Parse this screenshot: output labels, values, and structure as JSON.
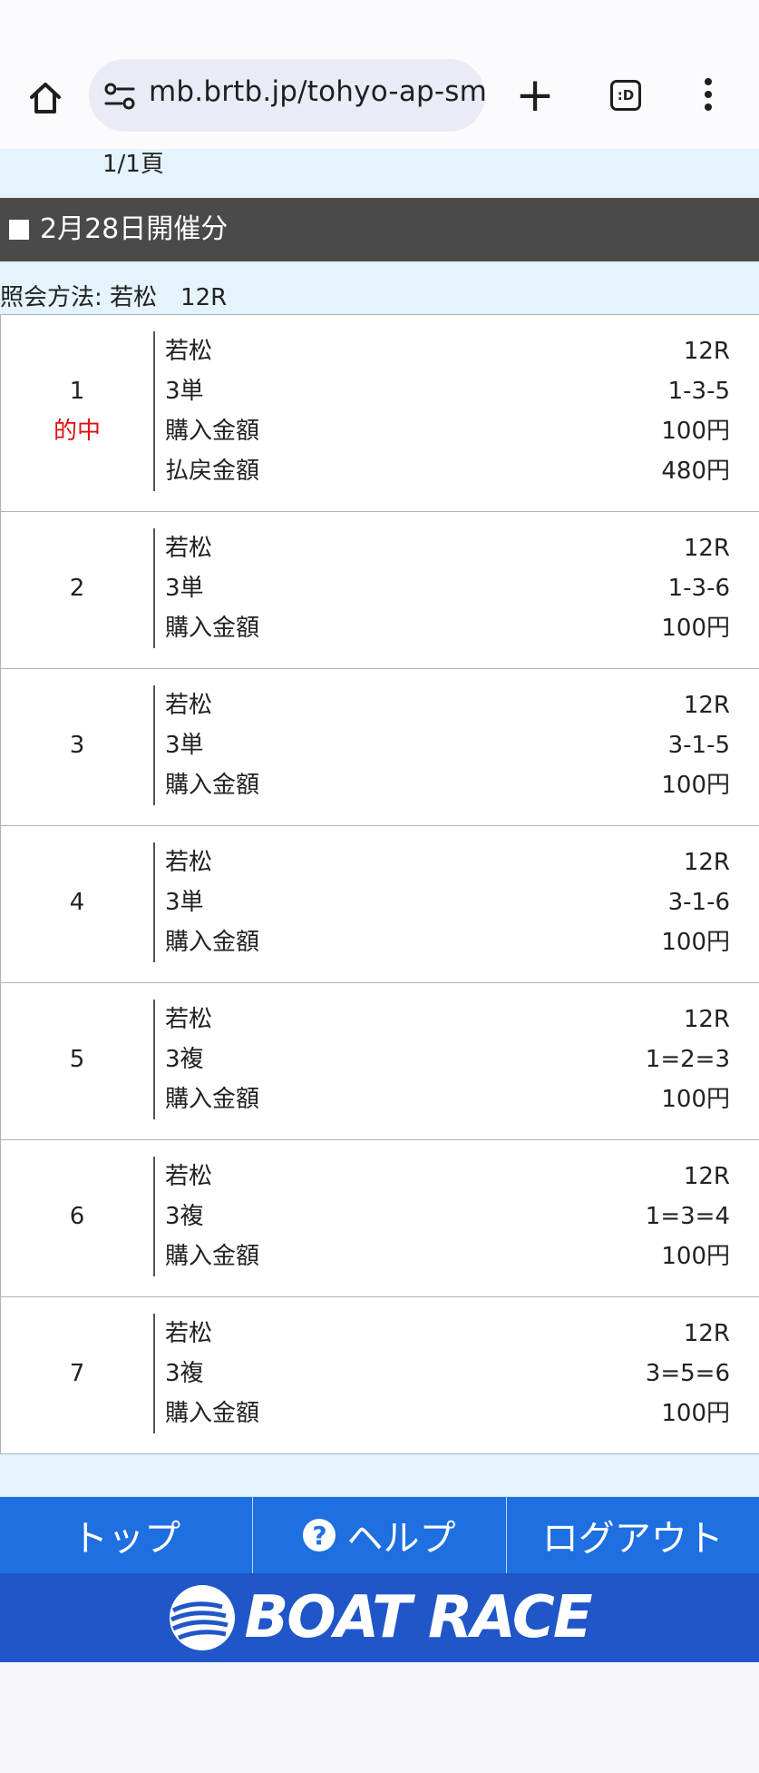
{
  "browser": {
    "url": "mb.brtb.jp/tohyo-ap-smt",
    "tabs_label": ":D"
  },
  "page": {
    "pager": "1/1頁",
    "date_header": "2月28日開催分",
    "query_method": "照会方法: 若松　12R"
  },
  "bets": [
    {
      "num": "1",
      "status": "的中",
      "venue": "若松",
      "race": "12R",
      "type": "3単",
      "combo": "1-3-5",
      "amount_label": "購入金額",
      "amount": "100円",
      "payout_label": "払戻金額",
      "payout": "480円"
    },
    {
      "num": "2",
      "venue": "若松",
      "race": "12R",
      "type": "3単",
      "combo": "1-3-6",
      "amount_label": "購入金額",
      "amount": "100円"
    },
    {
      "num": "3",
      "venue": "若松",
      "race": "12R",
      "type": "3単",
      "combo": "3-1-5",
      "amount_label": "購入金額",
      "amount": "100円"
    },
    {
      "num": "4",
      "venue": "若松",
      "race": "12R",
      "type": "3単",
      "combo": "3-1-6",
      "amount_label": "購入金額",
      "amount": "100円"
    },
    {
      "num": "5",
      "venue": "若松",
      "race": "12R",
      "type": "3複",
      "combo": "1=2=3",
      "amount_label": "購入金額",
      "amount": "100円"
    },
    {
      "num": "6",
      "venue": "若松",
      "race": "12R",
      "type": "3複",
      "combo": "1=3=4",
      "amount_label": "購入金額",
      "amount": "100円"
    },
    {
      "num": "7",
      "venue": "若松",
      "race": "12R",
      "type": "3複",
      "combo": "3=5=6",
      "amount_label": "購入金額",
      "amount": "100円"
    }
  ],
  "footer": {
    "top_label": "トップ",
    "help_label": "ヘルプ",
    "logout_label": "ログアウト",
    "brand": "BOAT RACE"
  },
  "colors": {
    "header_bg": "#4a4a4a",
    "light_bg": "#e5f3fc",
    "hit_red": "#e01010",
    "nav_blue": "#1e6fe0",
    "brand_blue": "#2056c8"
  }
}
